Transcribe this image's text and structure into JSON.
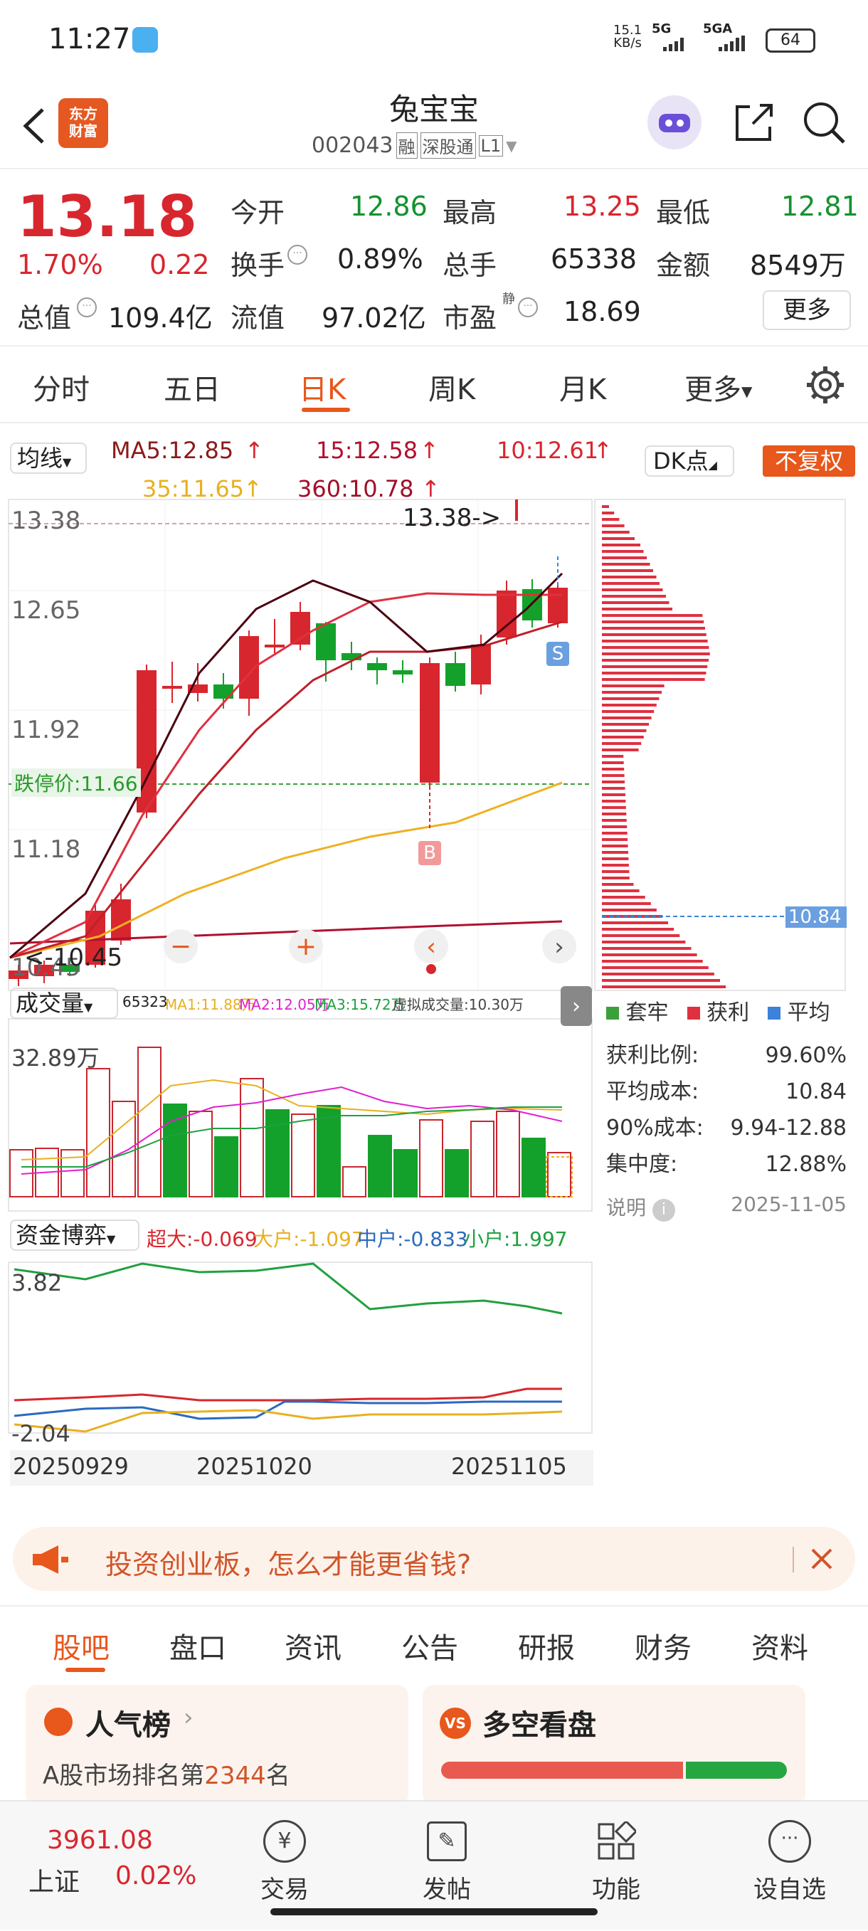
{
  "status": {
    "time": "11:27",
    "speed_top": "15.1",
    "speed_unit": "KB/s",
    "net1": "5G",
    "net2": "5GA",
    "battery": "64"
  },
  "nav": {
    "title": "兔宝宝",
    "code": "002043",
    "tag1": "融",
    "tag2": "深股通",
    "tag3": "L1",
    "logo_line1": "东方",
    "logo_line2": "财富"
  },
  "quote": {
    "price": "13.18",
    "pct": "1.70%",
    "chg": "0.22",
    "open_label": "今开",
    "open": "12.86",
    "high_label": "最高",
    "high": "13.25",
    "low_label": "最低",
    "low": "12.81",
    "turnover_label": "换手",
    "turnover": "0.89%",
    "volume_label": "总手",
    "volume": "65338",
    "amount_label": "金额",
    "amount": "8549万",
    "mcap_label": "总值",
    "mcap": "109.4亿",
    "float_label": "流值",
    "float": "97.02亿",
    "pe_label": "市盈",
    "pe_sup": "静",
    "pe": "18.69",
    "more": "更多"
  },
  "tabs": [
    "分时",
    "五日",
    "日K",
    "周K",
    "月K",
    "更多"
  ],
  "ma": {
    "selector": "均线",
    "ma5": "MA5:12.85",
    "ma15": "15:12.58",
    "ma10": "10:12.61",
    "ma35": "35:11.65",
    "ma360": "360:10.78",
    "dk": "DK点",
    "fuquan": "不复权"
  },
  "axis": {
    "p1": "13.38",
    "p2": "12.65",
    "p3": "11.92",
    "p4": "11.18",
    "p5": "10.45",
    "hi_label": "13.38->",
    "lo_label": "<-10.45",
    "limit_down": "跌停价:11.66",
    "buy": "B",
    "sell": "S"
  },
  "chip": {
    "avg_label": "10.84",
    "legend": [
      "套牢",
      "获利",
      "平均"
    ],
    "rows": [
      {
        "k": "获利比例:",
        "v": "99.60%"
      },
      {
        "k": "平均成本:",
        "v": "10.84"
      },
      {
        "k": "90%成本:",
        "v": "9.94-12.88"
      },
      {
        "k": "集中度:",
        "v": "12.88%"
      }
    ],
    "note": "说明",
    "date": "2025-11-05"
  },
  "volume": {
    "selector": "成交量",
    "v": "65323",
    "ma1": "MA1:11.88万",
    "ma2": "MA2:12.05万",
    "ma3": "MA3:15.72万",
    "virt": "虚拟成交量:10.30万",
    "max": "32.89万"
  },
  "capital": {
    "selector": "资金博弈",
    "cd": "超大:-0.069",
    "dh": "大户:-1.097",
    "zh": "中户:-0.833",
    "xh": "小户:1.997",
    "top": "3.82",
    "bottom": "-2.04"
  },
  "dates": [
    "20250929",
    "20251020",
    "20251105"
  ],
  "ad": {
    "text": "投资创业板，怎么才能更省钱?"
  },
  "subtabs": [
    "股吧",
    "盘口",
    "资讯",
    "公告",
    "研报",
    "财务",
    "资料"
  ],
  "cards": {
    "c1_title": "人气榜",
    "c1_prefix": "A股市场排名第",
    "c1_rank": "2344",
    "c1_suffix": "名",
    "c2_title": "多空看盘"
  },
  "bottom": {
    "index": "3961.08",
    "index_name": "上证",
    "index_pct": "0.02%",
    "items": [
      "交易",
      "发帖",
      "功能",
      "设自选"
    ]
  }
}
